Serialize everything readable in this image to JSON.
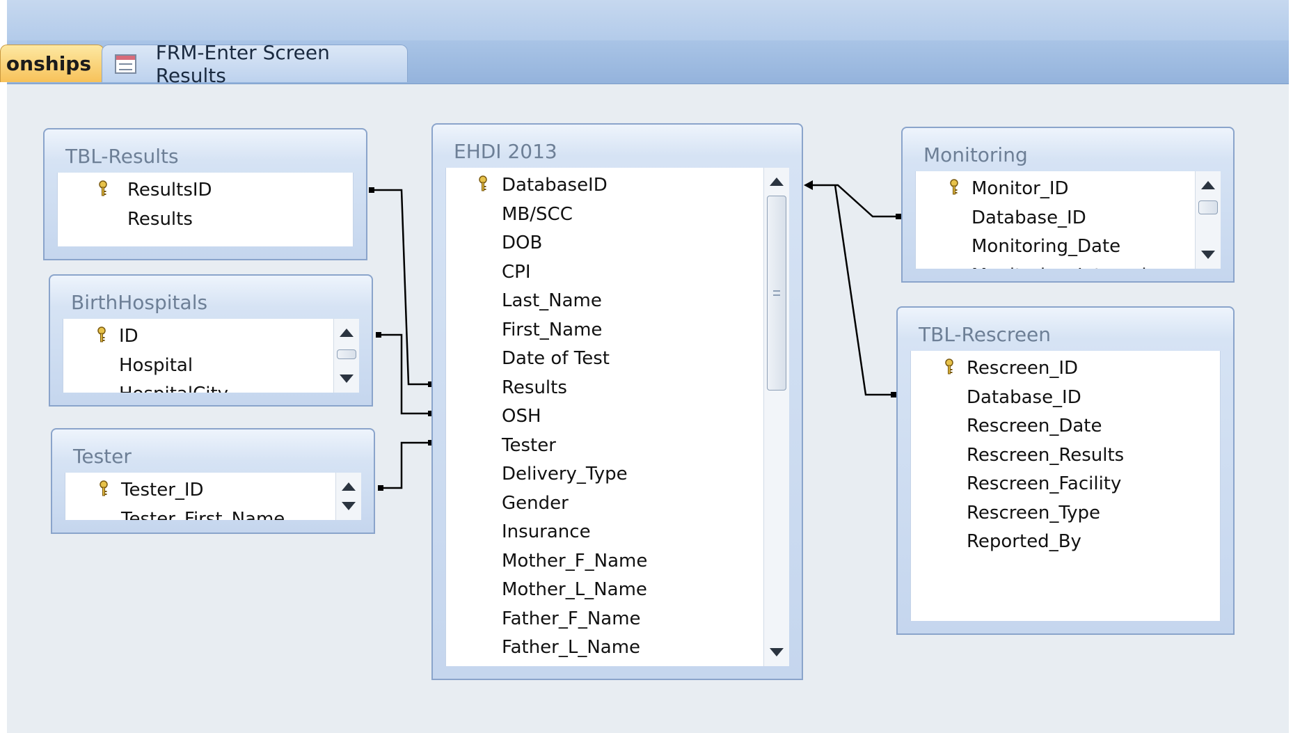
{
  "tabs": [
    {
      "label": "onships",
      "icon": "",
      "active": true
    },
    {
      "label": "FRM-Enter Screen Results",
      "icon": "form-icon",
      "active": false
    }
  ],
  "tables": {
    "tbl_results": {
      "title": "TBL-Results",
      "fields": [
        {
          "name": "ResultsID",
          "key": true
        },
        {
          "name": "Results",
          "key": false
        }
      ]
    },
    "birth_hospitals": {
      "title": "BirthHospitals",
      "fields": [
        {
          "name": "ID",
          "key": true
        },
        {
          "name": "Hospital",
          "key": false
        },
        {
          "name": "HospitalCity",
          "key": false
        }
      ]
    },
    "tester": {
      "title": "Tester",
      "fields": [
        {
          "name": "Tester_ID",
          "key": true
        },
        {
          "name": "Tester_First_Name",
          "key": false
        }
      ]
    },
    "ehdi": {
      "title": "EHDI 2013",
      "fields": [
        {
          "name": "DatabaseID",
          "key": true
        },
        {
          "name": "MB/SCC",
          "key": false
        },
        {
          "name": "DOB",
          "key": false
        },
        {
          "name": "CPI",
          "key": false
        },
        {
          "name": "Last_Name",
          "key": false
        },
        {
          "name": "First_Name",
          "key": false
        },
        {
          "name": "Date of Test",
          "key": false
        },
        {
          "name": "Results",
          "key": false
        },
        {
          "name": "OSH",
          "key": false
        },
        {
          "name": "Tester",
          "key": false
        },
        {
          "name": "Delivery_Type",
          "key": false
        },
        {
          "name": "Gender",
          "key": false
        },
        {
          "name": "Insurance",
          "key": false
        },
        {
          "name": "Mother_F_Name",
          "key": false
        },
        {
          "name": "Mother_L_Name",
          "key": false
        },
        {
          "name": "Father_F_Name",
          "key": false
        },
        {
          "name": "Father_L_Name",
          "key": false
        }
      ]
    },
    "monitoring": {
      "title": "Monitoring",
      "fields": [
        {
          "name": "Monitor_ID",
          "key": true
        },
        {
          "name": "Database_ID",
          "key": false
        },
        {
          "name": "Monitoring_Date",
          "key": false
        },
        {
          "name": "Monitoring_Interval",
          "key": false
        }
      ]
    },
    "tbl_rescreen": {
      "title": "TBL-Rescreen",
      "fields": [
        {
          "name": "Rescreen_ID",
          "key": true
        },
        {
          "name": "Database_ID",
          "key": false
        },
        {
          "name": "Rescreen_Date",
          "key": false
        },
        {
          "name": "Rescreen_Results",
          "key": false
        },
        {
          "name": "Rescreen_Facility",
          "key": false
        },
        {
          "name": "Rescreen_Type",
          "key": false
        },
        {
          "name": "Reported_By",
          "key": false
        }
      ]
    }
  },
  "colors": {
    "workspace": "#e8edf2",
    "table_border": "#8aa4cb",
    "active_tab": "#f7c25a",
    "relationship_line": "#000000"
  }
}
